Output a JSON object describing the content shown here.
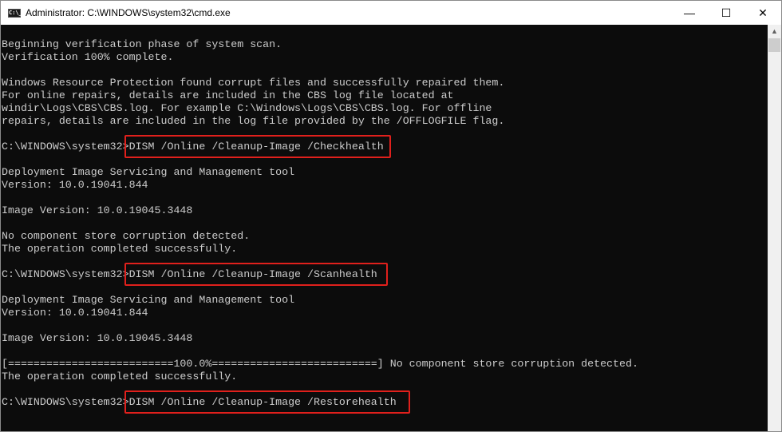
{
  "window": {
    "title": "Administrator: C:\\WINDOWS\\system32\\cmd.exe",
    "icon_text": "C:\\_"
  },
  "controls": {
    "minimize": "—",
    "maximize": "☐",
    "close": "✕"
  },
  "terminal": {
    "lines": [
      "Beginning verification phase of system scan.",
      "Verification 100% complete.",
      "",
      "Windows Resource Protection found corrupt files and successfully repaired them.",
      "For online repairs, details are included in the CBS log file located at",
      "windir\\Logs\\CBS\\CBS.log. For example C:\\Windows\\Logs\\CBS\\CBS.log. For offline",
      "repairs, details are included in the log file provided by the /OFFLOGFILE flag.",
      "",
      "C:\\WINDOWS\\system32>DISM /Online /Cleanup-Image /Checkhealth",
      "",
      "Deployment Image Servicing and Management tool",
      "Version: 10.0.19041.844",
      "",
      "Image Version: 10.0.19045.3448",
      "",
      "No component store corruption detected.",
      "The operation completed successfully.",
      "",
      "C:\\WINDOWS\\system32>DISM /Online /Cleanup-Image /Scanhealth",
      "",
      "Deployment Image Servicing and Management tool",
      "Version: 10.0.19041.844",
      "",
      "Image Version: 10.0.19045.3448",
      "",
      "[==========================100.0%==========================] No component store corruption detected.",
      "The operation completed successfully.",
      "",
      "C:\\WINDOWS\\system32>DISM /Online /Cleanup-Image /Restorehealth"
    ]
  },
  "highlight_color": "#e0201c"
}
